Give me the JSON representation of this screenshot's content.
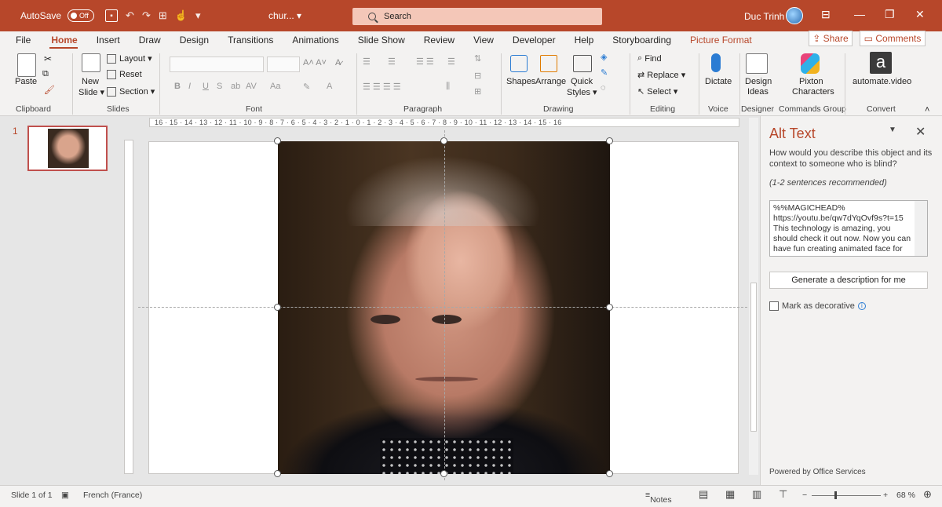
{
  "titlebar": {
    "autosave_label": "AutoSave",
    "autosave_state": "Off",
    "doc_name": "chur...",
    "search_placeholder": "Search",
    "user_name": "Duc Trinh"
  },
  "tabs": [
    "File",
    "Home",
    "Insert",
    "Draw",
    "Design",
    "Transitions",
    "Animations",
    "Slide Show",
    "Review",
    "View",
    "Developer",
    "Help",
    "Storyboarding",
    "Picture Format"
  ],
  "active_tab": "Home",
  "share_label": "Share",
  "comments_label": "Comments",
  "ribbon": {
    "clipboard": {
      "paste": "Paste",
      "group": "Clipboard"
    },
    "slides": {
      "new_slide_1": "New",
      "new_slide_2": "Slide",
      "layout": "Layout",
      "reset": "Reset",
      "section": "Section",
      "group": "Slides"
    },
    "font": {
      "group": "Font"
    },
    "paragraph": {
      "group": "Paragraph"
    },
    "drawing": {
      "shapes": "Shapes",
      "arrange": "Arrange",
      "quick_1": "Quick",
      "quick_2": "Styles",
      "group": "Drawing"
    },
    "editing": {
      "find": "Find",
      "replace": "Replace",
      "select": "Select",
      "group": "Editing"
    },
    "voice": {
      "dictate": "Dictate",
      "group": "Voice"
    },
    "designer": {
      "ideas_1": "Design",
      "ideas_2": "Ideas",
      "group": "Designer"
    },
    "commands": {
      "pixton_1": "Pixton",
      "pixton_2": "Characters",
      "group": "Commands Group"
    },
    "convert": {
      "automate": "automate.video",
      "group": "Convert"
    }
  },
  "thumbnails": {
    "number": "1"
  },
  "ruler_text": "16 · 15 · 14 · 13 · 12 · 11 · 10 · 9 · 8 · 7 · 6 · 5 · 4 · 3 · 2 · 1 · 0 · 1 · 2 · 3 · 4 · 5 · 6 · 7 · 8 · 9 · 10 · 11 · 12 · 13 · 14 · 15 · 16",
  "alt_text_pane": {
    "title": "Alt Text",
    "description": "How would you describe this object and its context to someone who is blind?",
    "recommendation": "(1-2 sentences recommended)",
    "text_value": "%%MAGICHEAD%\nhttps://youtu.be/qw7dYqOvf9s?t=15\nThis technology is amazing, you should check it out now. Now you can have fun creating animated face for",
    "generate_button": "Generate a description for me",
    "decorative_label": "Mark as decorative",
    "powered_by": "Powered by Office Services"
  },
  "status": {
    "slide_info": "Slide 1 of 1",
    "language": "French (France)",
    "notes": "Notes",
    "zoom": "68 %"
  },
  "colors": {
    "accent": "#b7472a",
    "titlebar": "#b7472a"
  }
}
